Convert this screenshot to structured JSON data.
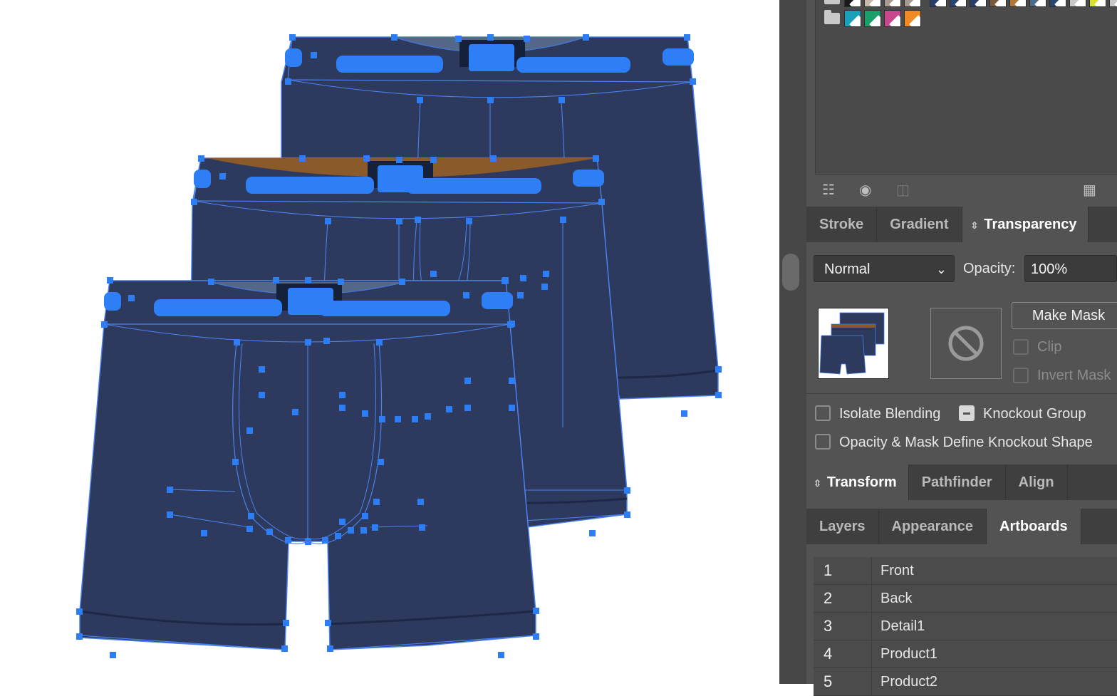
{
  "swatches": {
    "top_row_colors": [
      "#1a1a1a",
      "#c9b9a8",
      "#a79b8f",
      "#2a3d6a",
      "#26456f",
      "#7a5a3a",
      "#b0763a",
      "#4a6a8a",
      "#d8e030",
      "#c8c8c8"
    ],
    "group_colors": [
      "#1aa0b8",
      "#1a9e6a",
      "#c8488e",
      "#f08a24"
    ]
  },
  "icons": {
    "library": "libraries-icon",
    "assets": "asset-export-icon",
    "place": "place-icon",
    "grid": "grid-view-icon"
  },
  "tabs_top": [
    {
      "label": "Stroke"
    },
    {
      "label": "Gradient"
    },
    {
      "label": "Transparency"
    }
  ],
  "transparency": {
    "blend_mode": "Normal",
    "opacity_label": "Opacity:",
    "opacity_value": "100%",
    "make_mask": "Make Mask",
    "clip": "Clip",
    "invert_mask": "Invert Mask",
    "isolate_blending": "Isolate Blending",
    "knockout_group": "Knockout Group",
    "opacity_mask_knockout": "Opacity & Mask Define Knockout Shape"
  },
  "tabs_mid": [
    {
      "label": "Transform"
    },
    {
      "label": "Pathfinder"
    },
    {
      "label": "Align"
    }
  ],
  "tabs_bottom": [
    {
      "label": "Layers"
    },
    {
      "label": "Appearance"
    },
    {
      "label": "Artboards"
    }
  ],
  "artboards": [
    {
      "num": "1",
      "name": "Front"
    },
    {
      "num": "2",
      "name": "Back"
    },
    {
      "num": "3",
      "name": "Detail1"
    },
    {
      "num": "4",
      "name": "Product1"
    },
    {
      "num": "5",
      "name": "Product2"
    }
  ],
  "colors": {
    "garment": "#2d3a5e",
    "selection": "#2d7df5",
    "waistband_accent": "#8a5a2a"
  }
}
